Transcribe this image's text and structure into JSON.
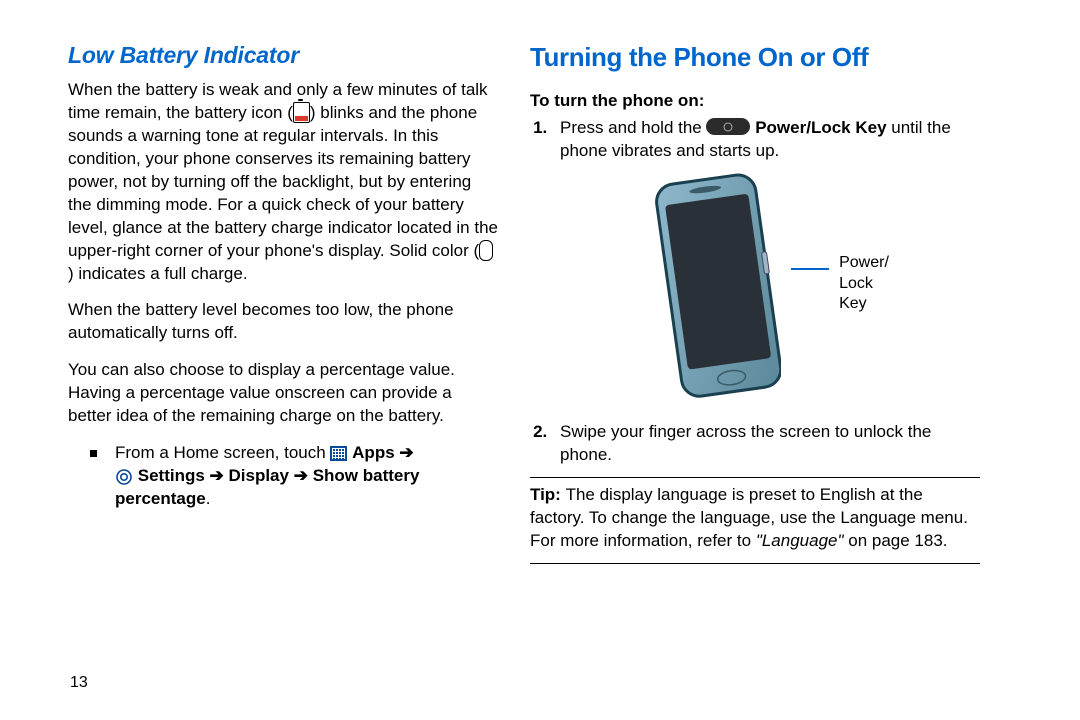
{
  "left": {
    "heading": "Low Battery Indicator",
    "p1a": "When the battery is weak and only a few minutes of talk time remain, the battery icon (",
    "p1b": ") blinks and the phone sounds a warning tone at regular intervals. In this condition, your phone conserves its remaining battery power, not by turning off the backlight, but by entering the dimming mode. For a quick check of your battery level, glance at the battery charge indicator located in the upper-right corner of your phone's display. Solid color (",
    "p1c": ") indicates a full charge.",
    "p2": "When the battery level becomes too low, the phone automatically turns off.",
    "p3": "You can also choose to display a percentage value. Having a percentage value onscreen can provide a better idea of the remaining charge on the battery.",
    "bullet_a": "From a Home screen, touch ",
    "bullet_apps": "Apps",
    "arrow1": " ➔ ",
    "bullet_settings": "Settings",
    "arrow2": " ➔ ",
    "bullet_display": "Display",
    "arrow3": " ➔ ",
    "bullet_show": "Show battery percentage",
    "bullet_dot": "."
  },
  "right": {
    "heading": "Turning the Phone On or Off",
    "sub": "To turn the phone on:",
    "s1a": "Press and hold the ",
    "s1b": " Power/Lock Key",
    "s1c": " until the phone vibrates and starts up.",
    "label_line1": "Power/",
    "label_line2": "Lock",
    "label_line3": "Key",
    "s2": "Swipe your finger across the screen to unlock the phone.",
    "tip_label": "Tip: ",
    "tip_text_a": "The display language is preset to English at the factory. To change the language, use the Language menu. For more information, refer to ",
    "tip_ref": "\"Language\"",
    "tip_text_b": " on page 183."
  },
  "page_num": "13"
}
